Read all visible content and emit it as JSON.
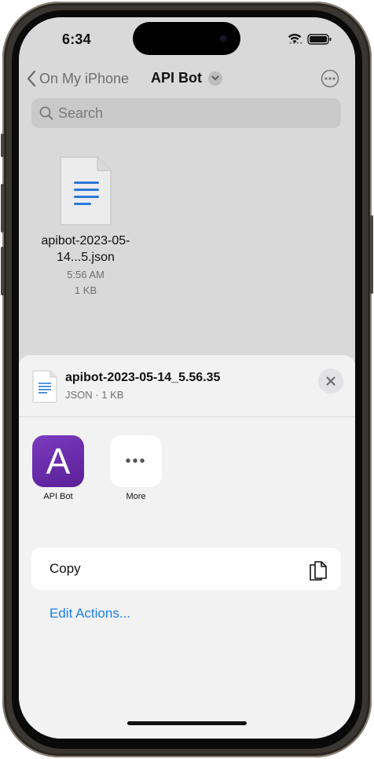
{
  "status": {
    "time": "6:34"
  },
  "nav": {
    "back_label": "On My iPhone",
    "title": "API Bot"
  },
  "search": {
    "placeholder": "Search"
  },
  "file": {
    "name": "apibot-2023-05-14...5.json",
    "time": "5:56 AM",
    "size": "1 KB"
  },
  "share_sheet": {
    "title": "apibot-2023-05-14_5.56.35",
    "subtitle": "JSON · 1 KB",
    "apps": [
      {
        "label": "API Bot",
        "glyph": "A",
        "icon": "apibot-app-icon"
      },
      {
        "label": "More",
        "glyph": "•••",
        "icon": "more-icon"
      }
    ],
    "actions": [
      {
        "label": "Copy",
        "icon": "copy-icon"
      }
    ],
    "edit_actions_label": "Edit Actions..."
  },
  "colors": {
    "accent": "#1a7ee8",
    "app_purple": "#6a2aab"
  }
}
